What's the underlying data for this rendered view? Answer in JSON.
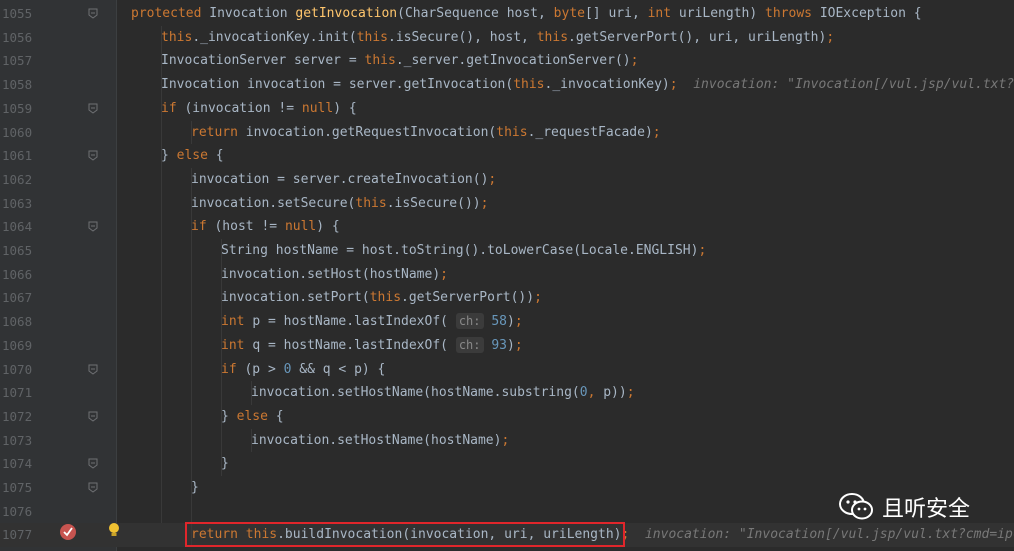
{
  "editor": {
    "lines": [
      {
        "no": "1055",
        "indent": 0,
        "fold": "open",
        "segments": [
          [
            "kw",
            "protected "
          ],
          [
            "t",
            "Invocation "
          ],
          [
            "fn",
            "getInvocation"
          ],
          [
            "t",
            "(CharSequence host, "
          ],
          [
            "kw",
            "byte"
          ],
          [
            "t",
            "[] uri, "
          ],
          [
            "kw",
            "int "
          ],
          [
            "t",
            "uriLength) "
          ],
          [
            "kw",
            "throws "
          ],
          [
            "t",
            "IOException {"
          ]
        ]
      },
      {
        "no": "1056",
        "indent": 1,
        "segments": [
          [
            "kw",
            "this"
          ],
          [
            "t",
            "._invocationKey.init("
          ],
          [
            "kw",
            "this"
          ],
          [
            "t",
            ".isSecure(), host, "
          ],
          [
            "kw",
            "this"
          ],
          [
            "t",
            ".getServerPort(), uri, uriLength)"
          ],
          [
            "kw",
            ";"
          ]
        ]
      },
      {
        "no": "1057",
        "indent": 1,
        "segments": [
          [
            "t",
            "InvocationServer server = "
          ],
          [
            "kw",
            "this"
          ],
          [
            "t",
            "._server.getInvocationServer()"
          ],
          [
            "kw",
            ";"
          ]
        ]
      },
      {
        "no": "1058",
        "indent": 1,
        "segments": [
          [
            "t",
            "Invocation invocation = server.getInvocation("
          ],
          [
            "kw",
            "this"
          ],
          [
            "t",
            "._invocationKey)"
          ],
          [
            "kw",
            ";"
          ],
          [
            "hint",
            "  invocation: \"Invocation[/vul.jsp/vul.txt?cmd"
          ]
        ]
      },
      {
        "no": "1059",
        "indent": 1,
        "fold": "open",
        "segments": [
          [
            "kw",
            "if "
          ],
          [
            "t",
            "(invocation != "
          ],
          [
            "kw",
            "null"
          ],
          [
            "t",
            ") {"
          ]
        ]
      },
      {
        "no": "1060",
        "indent": 2,
        "segments": [
          [
            "kw",
            "return "
          ],
          [
            "t",
            "invocation.getRequestInvocation("
          ],
          [
            "kw",
            "this"
          ],
          [
            "t",
            "._requestFacade)"
          ],
          [
            "kw",
            ";"
          ]
        ]
      },
      {
        "no": "1061",
        "indent": 1,
        "fold": "close",
        "segments": [
          [
            "t",
            "} "
          ],
          [
            "kw",
            "else "
          ],
          [
            "t",
            "{"
          ]
        ]
      },
      {
        "no": "1062",
        "indent": 2,
        "segments": [
          [
            "t",
            "invocation = server.createInvocation()"
          ],
          [
            "kw",
            ";"
          ]
        ]
      },
      {
        "no": "1063",
        "indent": 2,
        "segments": [
          [
            "t",
            "invocation.setSecure("
          ],
          [
            "kw",
            "this"
          ],
          [
            "t",
            ".isSecure())"
          ],
          [
            "kw",
            ";"
          ]
        ]
      },
      {
        "no": "1064",
        "indent": 2,
        "fold": "open",
        "segments": [
          [
            "kw",
            "if "
          ],
          [
            "t",
            "(host != "
          ],
          [
            "kw",
            "null"
          ],
          [
            "t",
            ") {"
          ]
        ]
      },
      {
        "no": "1065",
        "indent": 3,
        "segments": [
          [
            "t",
            "String hostName = host.toString().toLowerCase(Locale.ENGLISH)"
          ],
          [
            "kw",
            ";"
          ]
        ]
      },
      {
        "no": "1066",
        "indent": 3,
        "segments": [
          [
            "t",
            "invocation.setHost(hostName)"
          ],
          [
            "kw",
            ";"
          ]
        ]
      },
      {
        "no": "1067",
        "indent": 3,
        "segments": [
          [
            "t",
            "invocation.setPort("
          ],
          [
            "kw",
            "this"
          ],
          [
            "t",
            ".getServerPort())"
          ],
          [
            "kw",
            ";"
          ]
        ]
      },
      {
        "no": "1068",
        "indent": 3,
        "segments": [
          [
            "kw",
            "int "
          ],
          [
            "t",
            "p = hostName.lastIndexOf( "
          ],
          [
            "param",
            "ch:"
          ],
          [
            "num",
            " 58"
          ],
          [
            "t",
            ")"
          ],
          [
            "kw",
            ";"
          ]
        ]
      },
      {
        "no": "1069",
        "indent": 3,
        "segments": [
          [
            "kw",
            "int "
          ],
          [
            "t",
            "q = hostName.lastIndexOf( "
          ],
          [
            "param",
            "ch:"
          ],
          [
            "num",
            " 93"
          ],
          [
            "t",
            ")"
          ],
          [
            "kw",
            ";"
          ]
        ]
      },
      {
        "no": "1070",
        "indent": 3,
        "fold": "open",
        "segments": [
          [
            "kw",
            "if "
          ],
          [
            "t",
            "(p > "
          ],
          [
            "num",
            "0 "
          ],
          [
            "t",
            "&& q < p) {"
          ]
        ]
      },
      {
        "no": "1071",
        "indent": 4,
        "segments": [
          [
            "t",
            "invocation.setHostName(hostName.substring("
          ],
          [
            "num",
            "0"
          ],
          [
            "kw",
            ", "
          ],
          [
            "t",
            "p))"
          ],
          [
            "kw",
            ";"
          ]
        ]
      },
      {
        "no": "1072",
        "indent": 3,
        "fold": "open",
        "segments": [
          [
            "t",
            "} "
          ],
          [
            "kw",
            "else "
          ],
          [
            "t",
            "{"
          ]
        ]
      },
      {
        "no": "1073",
        "indent": 4,
        "segments": [
          [
            "t",
            "invocation.setHostName(hostName)"
          ],
          [
            "kw",
            ";"
          ]
        ]
      },
      {
        "no": "1074",
        "indent": 3,
        "fold": "close",
        "segments": [
          [
            "t",
            "}"
          ]
        ]
      },
      {
        "no": "1075",
        "indent": 2,
        "fold": "close",
        "segments": [
          [
            "t",
            "}"
          ]
        ]
      },
      {
        "no": "1076",
        "indent": 0,
        "segments": []
      },
      {
        "no": "1077",
        "indent": 2,
        "current": true,
        "segments": [
          [
            "kw",
            "return "
          ],
          [
            "kw",
            "this"
          ],
          [
            "t",
            ".buildInvocation(invocation, uri, uriLength)"
          ],
          [
            "kw",
            ";"
          ],
          [
            "hint",
            "  invocation: \"Invocation[/vul.jsp/vul.txt?cmd=ipconf"
          ]
        ]
      }
    ]
  },
  "watermark": {
    "text": "且听安全"
  },
  "colors": {
    "background": "#2b2b2b",
    "keyword": "#cc7832",
    "method": "#ffc66d",
    "number": "#6897bb",
    "text": "#a9b7c6",
    "highlight_box": "#e0262b"
  }
}
